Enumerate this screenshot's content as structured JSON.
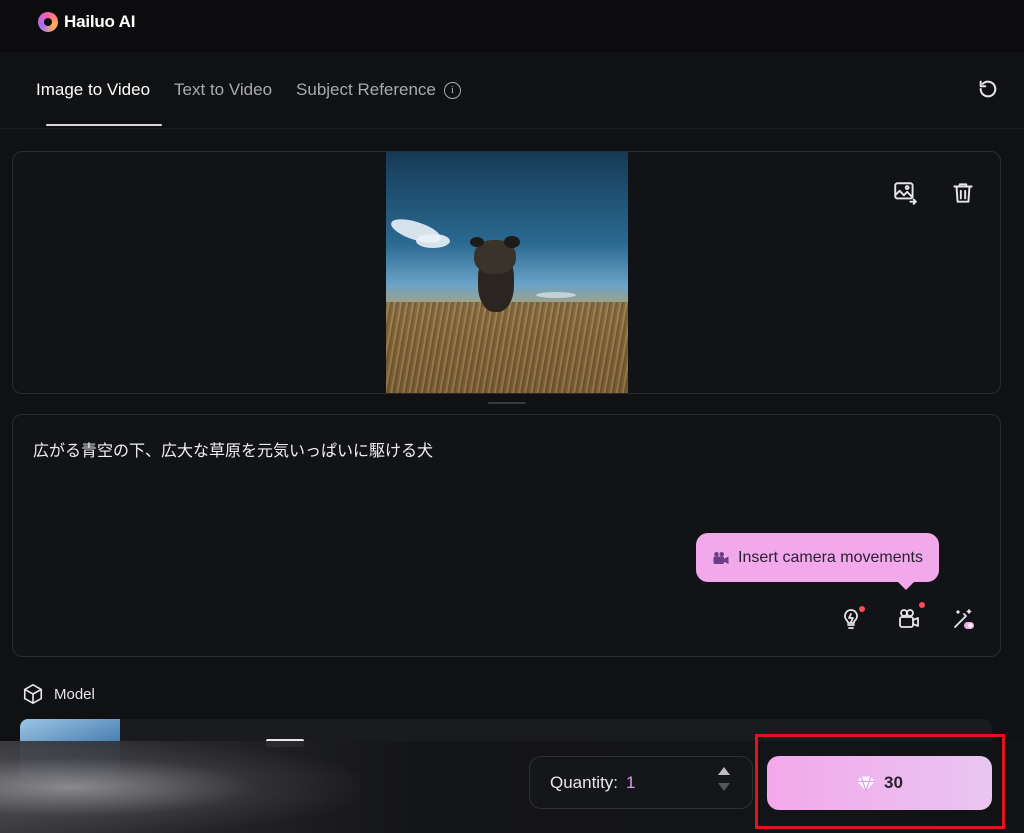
{
  "app": {
    "logo_text": "Hailuo AI",
    "logo_icon": "hailuo-logo-icon"
  },
  "tabs": [
    {
      "label": "Image to Video",
      "active": true
    },
    {
      "label": "Text to Video",
      "active": false
    },
    {
      "label": "Subject Reference",
      "active": false,
      "info_icon": "info-icon"
    }
  ],
  "toolbar": {
    "reset_icon": "refresh-icon"
  },
  "image_panel": {
    "replace_icon": "replace-image-icon",
    "delete_icon": "trash-icon"
  },
  "prompt": {
    "text": "広がる青空の下、広大な草原を元気いっぱいに駆ける犬",
    "tooltip": "Insert camera movements",
    "tools": [
      "lightbulb-icon",
      "camera-icon",
      "magic-wand-icon"
    ]
  },
  "model": {
    "label": "Model",
    "icon": "cube-icon"
  },
  "footer": {
    "quantity_label": "Quantity:",
    "quantity_value": "1",
    "generate_cost": "30",
    "generate_icon": "credit-gem-icon"
  },
  "colors": {
    "accent_pink": "#f2a8ea",
    "highlight_red": "#e0141b",
    "background": "#101113"
  }
}
